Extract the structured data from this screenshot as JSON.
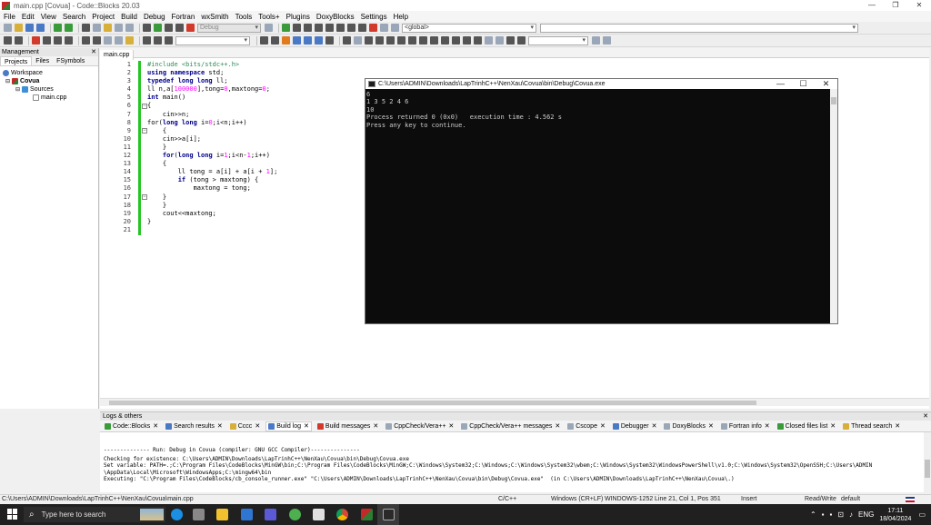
{
  "window": {
    "title": "main.cpp [Covua] - Code::Blocks 20.03",
    "controls": [
      "—",
      "❐",
      "✕"
    ]
  },
  "menu": [
    "File",
    "Edit",
    "View",
    "Search",
    "Project",
    "Build",
    "Debug",
    "Fortran",
    "wxSmith",
    "Tools",
    "Tools+",
    "Plugins",
    "DoxyBlocks",
    "Settings",
    "Help"
  ],
  "toolbar": {
    "build_target": "Debug",
    "scope": "<global>"
  },
  "management": {
    "header": "Management",
    "tabs": [
      "Projects",
      "Files",
      "FSymbols"
    ],
    "tree": {
      "workspace": "Workspace",
      "project": "Covua",
      "folder": "Sources",
      "file": "main.cpp"
    }
  },
  "editor": {
    "tab": "main.cpp",
    "line_numbers": [
      "1",
      "2",
      "3",
      "4",
      "5",
      "6",
      "7",
      "8",
      "9",
      "10",
      "11",
      "12",
      "13",
      "14",
      "15",
      "16",
      "17",
      "18",
      "19",
      "20",
      "21"
    ]
  },
  "console": {
    "title": "C:\\Users\\ADMIN\\Downloads\\LapTrinhC++\\NenXau\\Covua\\bin\\Debug\\Covua.exe",
    "lines": [
      "6",
      "1 3 5 2 4 6",
      "10",
      "Process returned 0 (0x0)   execution time : 4.562 s",
      "Press any key to continue."
    ]
  },
  "logs": {
    "header": "Logs & others",
    "tabs": [
      {
        "label": "Code::Blocks",
        "color": "#3a9b3a"
      },
      {
        "label": "Search results",
        "color": "#4a79c6"
      },
      {
        "label": "Cccc",
        "color": "#d6b03a"
      },
      {
        "label": "Build log",
        "color": "#4a79c6"
      },
      {
        "label": "Build messages",
        "color": "#d23b2b"
      },
      {
        "label": "CppCheck/Vera++",
        "color": "#9aa7b8"
      },
      {
        "label": "CppCheck/Vera++ messages",
        "color": "#9aa7b8"
      },
      {
        "label": "Cscope",
        "color": "#9aa7b8"
      },
      {
        "label": "Debugger",
        "color": "#4a79c6"
      },
      {
        "label": "DoxyBlocks",
        "color": "#9aa7b8"
      },
      {
        "label": "Fortran info",
        "color": "#9aa7b8"
      },
      {
        "label": "Closed files list",
        "color": "#3a9b3a"
      },
      {
        "label": "Thread search",
        "color": "#d6b03a"
      }
    ],
    "active_tab_index": 3,
    "lines": [
      "-------------- Run: Debug in Covua (compiler: GNU GCC Compiler)---------------",
      "Checking for existence: C:\\Users\\ADMIN\\Downloads\\LapTrinhC++\\NenXau\\Covua\\bin\\Debug\\Covua.exe",
      "Set variable: PATH=.;C:\\Program Files\\CodeBlocks\\MinGW\\bin;C:\\Program Files\\CodeBlocks\\MinGW;C:\\Windows\\System32;C:\\Windows;C:\\Windows\\System32\\wbem;C:\\Windows\\System32\\WindowsPowerShell\\v1.0;C:\\Windows\\System32\\OpenSSH;C:\\Users\\ADMIN",
      "\\AppData\\Local\\Microsoft\\WindowsApps;C:\\mingw64\\bin",
      "Executing: \"C:\\Program Files\\CodeBlocks/cb_console_runner.exe\" \"C:\\Users\\ADMIN\\Downloads\\LapTrinhC++\\NenXau\\Covua\\bin\\Debug\\Covua.exe\"  (in C:\\Users\\ADMIN\\Downloads\\LapTrinhC++\\NenXau\\Covua\\.)"
    ]
  },
  "status": {
    "path": "C:\\Users\\ADMIN\\Downloads\\LapTrinhC++\\NenXau\\Covua\\main.cpp",
    "language": "C/C++",
    "eol": "Windows (CR+LF)",
    "encoding": "WINDOWS-1252",
    "position": "Line 21, Col 1, Pos 351",
    "mode": "Insert",
    "access": "Read/Write",
    "profile": "default"
  },
  "taskbar": {
    "search_placeholder": "Type here to search",
    "language": "ENG",
    "time": "17:11",
    "date": "18/04/2024"
  }
}
